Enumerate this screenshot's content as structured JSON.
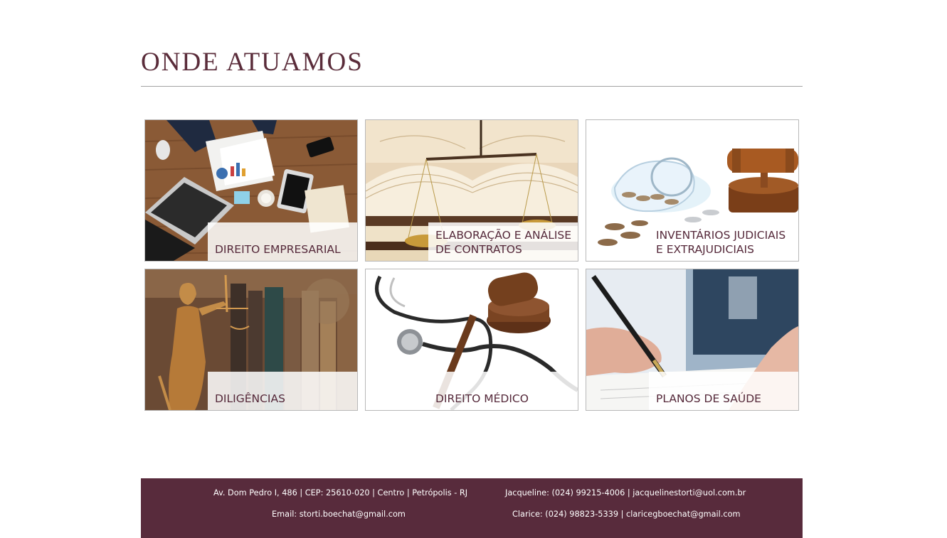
{
  "section": {
    "title": "ONDE ATUAMOS"
  },
  "areas": [
    {
      "label": "DIREITO EMPRESARIAL",
      "image": "business-desk-image"
    },
    {
      "label": "ELABORAÇÃO E ANÁLISE DE CONTRATOS",
      "image": "books-scale-image"
    },
    {
      "label": "INVENTÁRIOS JUDICIAIS E EXTRAJUDICIAIS",
      "image": "coins-gavel-image"
    },
    {
      "label": "DILIGÊNCIAS",
      "image": "justice-statue-image"
    },
    {
      "label": "DIREITO MÉDICO",
      "image": "stethoscope-gavel-image"
    },
    {
      "label": "PLANOS DE SAÚDE",
      "image": "signing-document-image"
    }
  ],
  "footer": {
    "address": "Av. Dom Pedro I, 486 | CEP: 25610-020 | Centro | Petrópolis - RJ",
    "email": "Email: storti.boechat@gmail.com",
    "contact_jacqueline": "Jacqueline: (024) 99215-4006 | jacquelinestorti@uol.com.br",
    "contact_clarice": "Clarice: (024) 98823-5339 | claricegboechat@gmail.com"
  },
  "colors": {
    "brand": "#582b3c",
    "title": "#5a2c3a",
    "rule": "#a3a3a3"
  }
}
